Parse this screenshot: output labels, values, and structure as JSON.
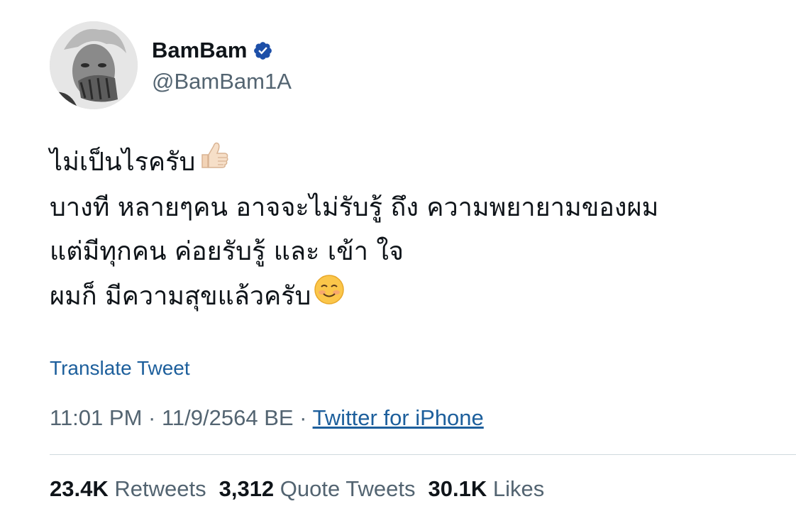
{
  "user": {
    "display_name": "BamBam",
    "handle": "@BamBam1A",
    "verified": true,
    "verified_color": "#1d9bf0",
    "avatar": "profile-photo"
  },
  "tweet": {
    "lines": [
      "ไม่เป็นไรครับ",
      "บางที หลายๆคน อาจจะไม่รับรู้ ถึง ความพยายามของผม",
      "แต่มีทุกคน ค่อยรับรู้ และ เข้า ใจ",
      "ผมก็ มีความสุขแล้วครับ"
    ],
    "emojis": [
      "thumbs-up",
      "smiling-face"
    ]
  },
  "translate_label": "Translate Tweet",
  "meta": {
    "time": "11:01 PM",
    "separator": "·",
    "date": "11/9/2564 BE",
    "source": "Twitter for iPhone"
  },
  "stats": {
    "retweets_count": "23.4K",
    "retweets_label": "Retweets",
    "quotes_count": "3,312",
    "quotes_label": "Quote Tweets",
    "likes_count": "30.1K",
    "likes_label": "Likes"
  },
  "colors": {
    "link": "#1d5f9c",
    "secondary_text": "#536471",
    "divider": "#cfd9de"
  }
}
